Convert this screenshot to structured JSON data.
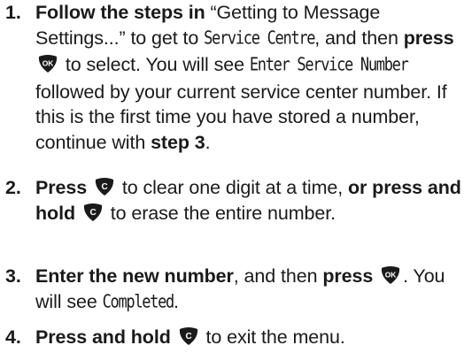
{
  "steps": [
    {
      "number": "1.",
      "parts": {
        "a_bold": "Follow the steps in",
        "b": " “Getting to Message Settings...” to get to ",
        "c_lcd": "Service Centre",
        "d": ", and then ",
        "e_bold": "press",
        "f_icon": "ok-key-icon",
        "g": " to select. You will see ",
        "h_lcd": "Enter Service Number",
        "i": " followed by your current service center number. If this is the first time you have stored a number, continue with ",
        "j_bold": "step 3",
        "k": "."
      }
    },
    {
      "number": "2.",
      "parts": {
        "a_bold": "Press",
        "b_icon": "clear-key-icon",
        "c": " to clear one digit at a time, ",
        "d_bold": "or press and hold",
        "e_icon": "clear-key-icon",
        "f": " to erase the entire number."
      }
    },
    {
      "number": "3.",
      "parts": {
        "a_bold": "Enter the new number",
        "b": ", and then ",
        "c_bold": "press",
        "d_icon": "ok-key-icon",
        "e": ". You will see ",
        "f_lcd": "Completed",
        "g": "."
      }
    },
    {
      "number": "4.",
      "parts": {
        "a_bold": "Press and hold",
        "b_icon": "clear-key-icon",
        "c": " to exit the menu."
      }
    }
  ],
  "icons": {
    "ok_key_label": "OK",
    "clear_key_label": "C",
    "key_color": "#1a1a1a",
    "key_text_color": "#ffffff"
  }
}
